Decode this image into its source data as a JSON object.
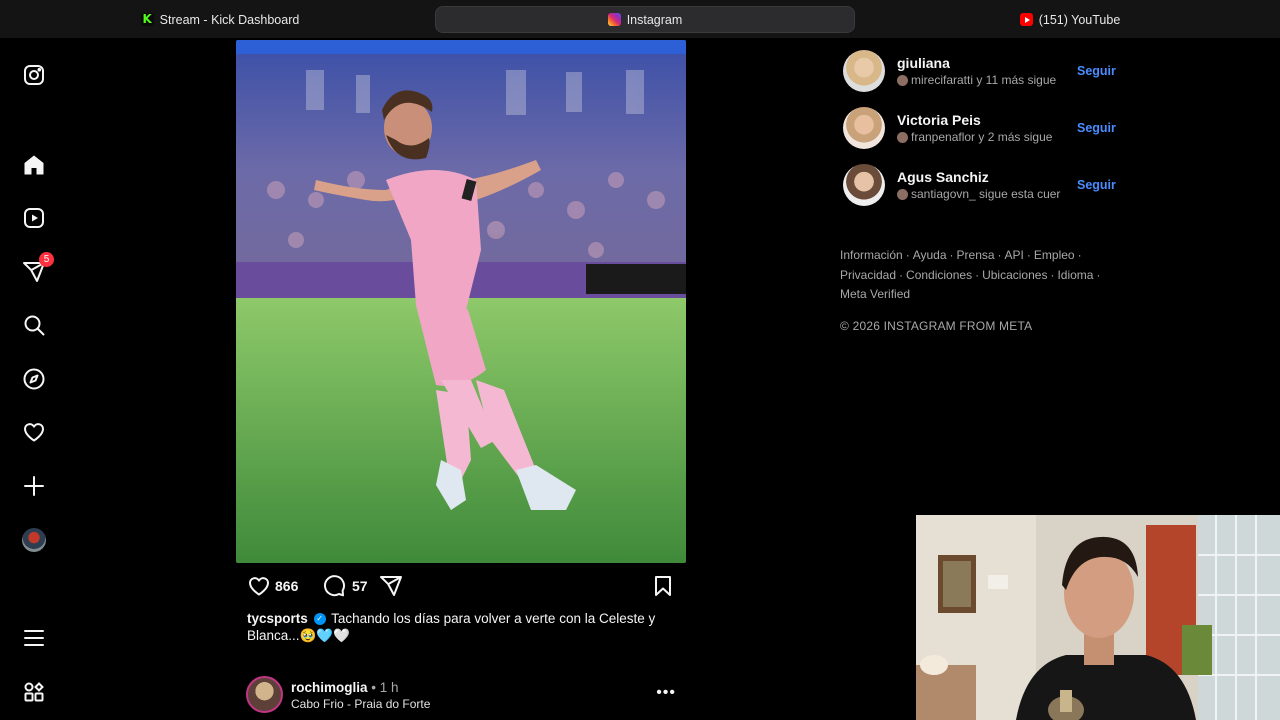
{
  "browser": {
    "tabs": [
      {
        "label": "Stream - Kick Dashboard",
        "icon": "kick-icon"
      },
      {
        "label": "Instagram",
        "icon": "instagram-icon",
        "active": true
      },
      {
        "label": "(151) YouTube",
        "icon": "youtube-icon"
      }
    ]
  },
  "nav": {
    "items": [
      "instagram-logo-icon",
      "home-icon",
      "reels-icon",
      "messages-icon",
      "search-icon",
      "explore-icon",
      "notifications-icon",
      "create-icon",
      "profile-avatar",
      "menu-icon",
      "more-apps-icon"
    ],
    "messages_badge": "5"
  },
  "post": {
    "likes": "866",
    "comments": "57",
    "caption_user": "tycsports",
    "caption_text": "Tachando los días para volver a verte con la Celeste y Blanca...🥹🩵🤍"
  },
  "next_post": {
    "user": "rochimoglia",
    "time": "• 1 h",
    "location": "Cabo Frio - Praia do Forte",
    "more": "•••"
  },
  "suggestions": [
    {
      "name": "giuliana",
      "sub": "mirecifaratti y 11 más sigue",
      "action": "Seguir"
    },
    {
      "name": "Victoria Peis",
      "sub": "franpenaflor y 2 más sigue",
      "action": "Seguir"
    },
    {
      "name": "Agus Sanchiz",
      "sub": "santiagovn_ sigue esta cuer",
      "action": "Seguir"
    }
  ],
  "footer": {
    "links": [
      "Información",
      "Ayuda",
      "Prensa",
      "API",
      "Empleo",
      "Privacidad",
      "Condiciones",
      "Ubicaciones",
      "Idioma",
      "Meta Verified"
    ],
    "copyright": "© 2026 INSTAGRAM FROM META"
  },
  "colors": {
    "background": "#000000",
    "link_blue": "#4a8cff",
    "badge_red": "#ff3040",
    "kick_green": "#53fc18"
  }
}
